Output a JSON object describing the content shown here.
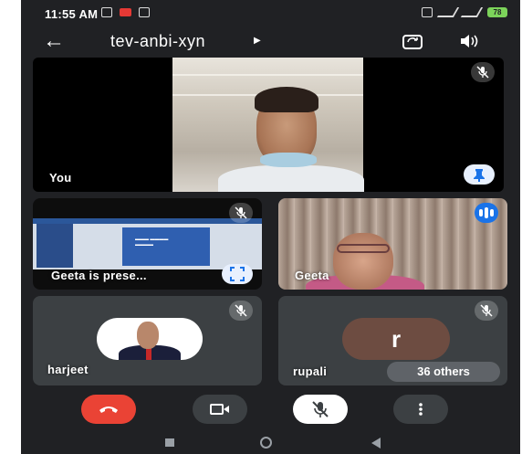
{
  "status_bar": {
    "time": "11:55 AM",
    "battery": "78"
  },
  "top_bar": {
    "meeting_code": "tev-anbi-xyn"
  },
  "participants": {
    "self_label": "You",
    "presenter_label": "Geeta is prese...",
    "geeta_label": "Geeta",
    "harjeet_label": "harjeet",
    "rupali_label": "rupali",
    "rupali_initial": "r",
    "others_label": "36 others"
  },
  "colors": {
    "end_call": "#ea4335",
    "speaking_accent": "#1a73e8",
    "background": "#202124",
    "tile": "#3c4043"
  },
  "icons": {
    "back": "arrow-left",
    "camera_switch": "camera-flip",
    "speaker": "volume-up",
    "mic_off": "mic-off",
    "pin": "pin",
    "fullscreen": "fullscreen",
    "speaking": "audio-wave",
    "end_call": "phone-hangup",
    "camera": "videocam-off",
    "more": "more-vert"
  }
}
